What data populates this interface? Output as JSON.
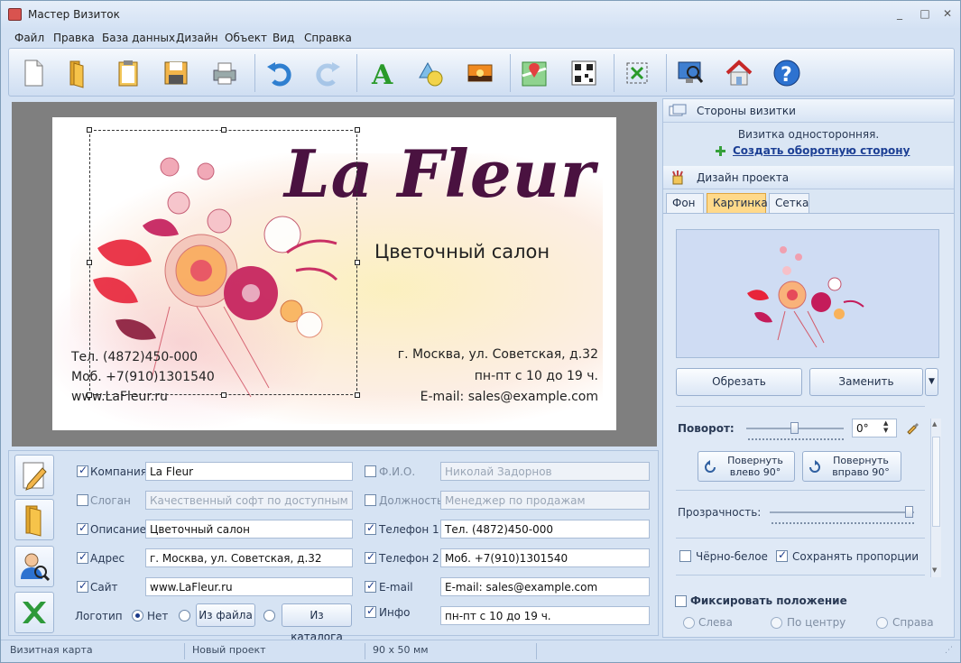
{
  "window": {
    "title": "Мастер Визиток",
    "minimize": "_",
    "maximize": "□",
    "close": "✕"
  },
  "menu": [
    "Файл",
    "Правка",
    "База данных",
    "Дизайн",
    "Объект",
    "Вид",
    "Справка"
  ],
  "toolbar": {
    "icons": [
      "new-icon",
      "open-folder-icon",
      "clipboard-icon",
      "save-icon",
      "print-icon",
      "undo-icon",
      "redo-icon",
      "text-tool-icon",
      "shapes-icon",
      "image-icon",
      "map-icon",
      "qr-code-icon",
      "fit-icon",
      "preview-icon",
      "home-icon",
      "help-icon"
    ]
  },
  "card": {
    "brand": "La Fleur",
    "subtitle": "Цветочный салон",
    "phone": "Тел. (4872)450-000",
    "mobile": "Моб. +7(910)1301540",
    "site": "www.LaFleur.ru",
    "address": "г. Москва, ул. Советская, д.32",
    "hours": "пн-пт с 10 до 19 ч.",
    "email": "E-mail: sales@example.com"
  },
  "fields": {
    "left": [
      {
        "label": "Компания",
        "value": "La Fleur",
        "checked": true
      },
      {
        "label": "Слоган",
        "value": "Качественный софт по доступным ценам",
        "checked": false
      },
      {
        "label": "Описание",
        "value": "Цветочный салон",
        "checked": true
      },
      {
        "label": "Адрес",
        "value": "г. Москва, ул. Советская, д.32",
        "checked": true
      },
      {
        "label": "Сайт",
        "value": "www.LaFleur.ru",
        "checked": true
      }
    ],
    "right": [
      {
        "label": "Ф.И.О.",
        "value": "Николай Задорнов",
        "checked": false
      },
      {
        "label": "Должность",
        "value": "Менеджер по продажам",
        "checked": false
      },
      {
        "label": "Телефон 1",
        "value": "Тел. (4872)450-000",
        "checked": true
      },
      {
        "label": "Телефон 2",
        "value": "Моб. +7(910)1301540",
        "checked": true
      },
      {
        "label": "E-mail",
        "value": "E-mail: sales@example.com",
        "checked": true
      },
      {
        "label": "Инфо",
        "value": "пн-пт с 10 до 19 ч.",
        "checked": true
      }
    ],
    "logo_label": "Логотип",
    "logo_none": "Нет",
    "logo_file": "Из файла",
    "logo_catalog": "Из каталога"
  },
  "sides": {
    "header": "Стороны визитки",
    "info": "Визитка односторонняя.",
    "create_back": "Создать оборотную сторону"
  },
  "design": {
    "header": "Дизайн проекта",
    "tabs": [
      "Фон",
      "Картинка",
      "Сетка"
    ],
    "active_tab": "Картинка",
    "crop": "Обрезать",
    "replace": "Заменить",
    "rotation_label": "Поворот:",
    "rotation_value": "0°",
    "rotate_left_1": "Повернуть",
    "rotate_left_2": "влево 90°",
    "rotate_right_1": "Повернуть",
    "rotate_right_2": "вправо 90°",
    "opacity_label": "Прозрачность:",
    "opacity_level": 1.0,
    "bw_label": "Чёрно-белое",
    "keep_ratio_label": "Сохранять пропорции",
    "fix_position": "Фиксировать положение",
    "align_left": "Слева",
    "align_center": "По центру",
    "align_right": "Справа"
  },
  "status": {
    "type": "Визитная карта",
    "project": "Новый проект",
    "size": "90 х 50 мм"
  },
  "colors": {
    "brand": "#4a1240",
    "accent_tab": "#ffd98a",
    "link": "#1c3f94"
  }
}
